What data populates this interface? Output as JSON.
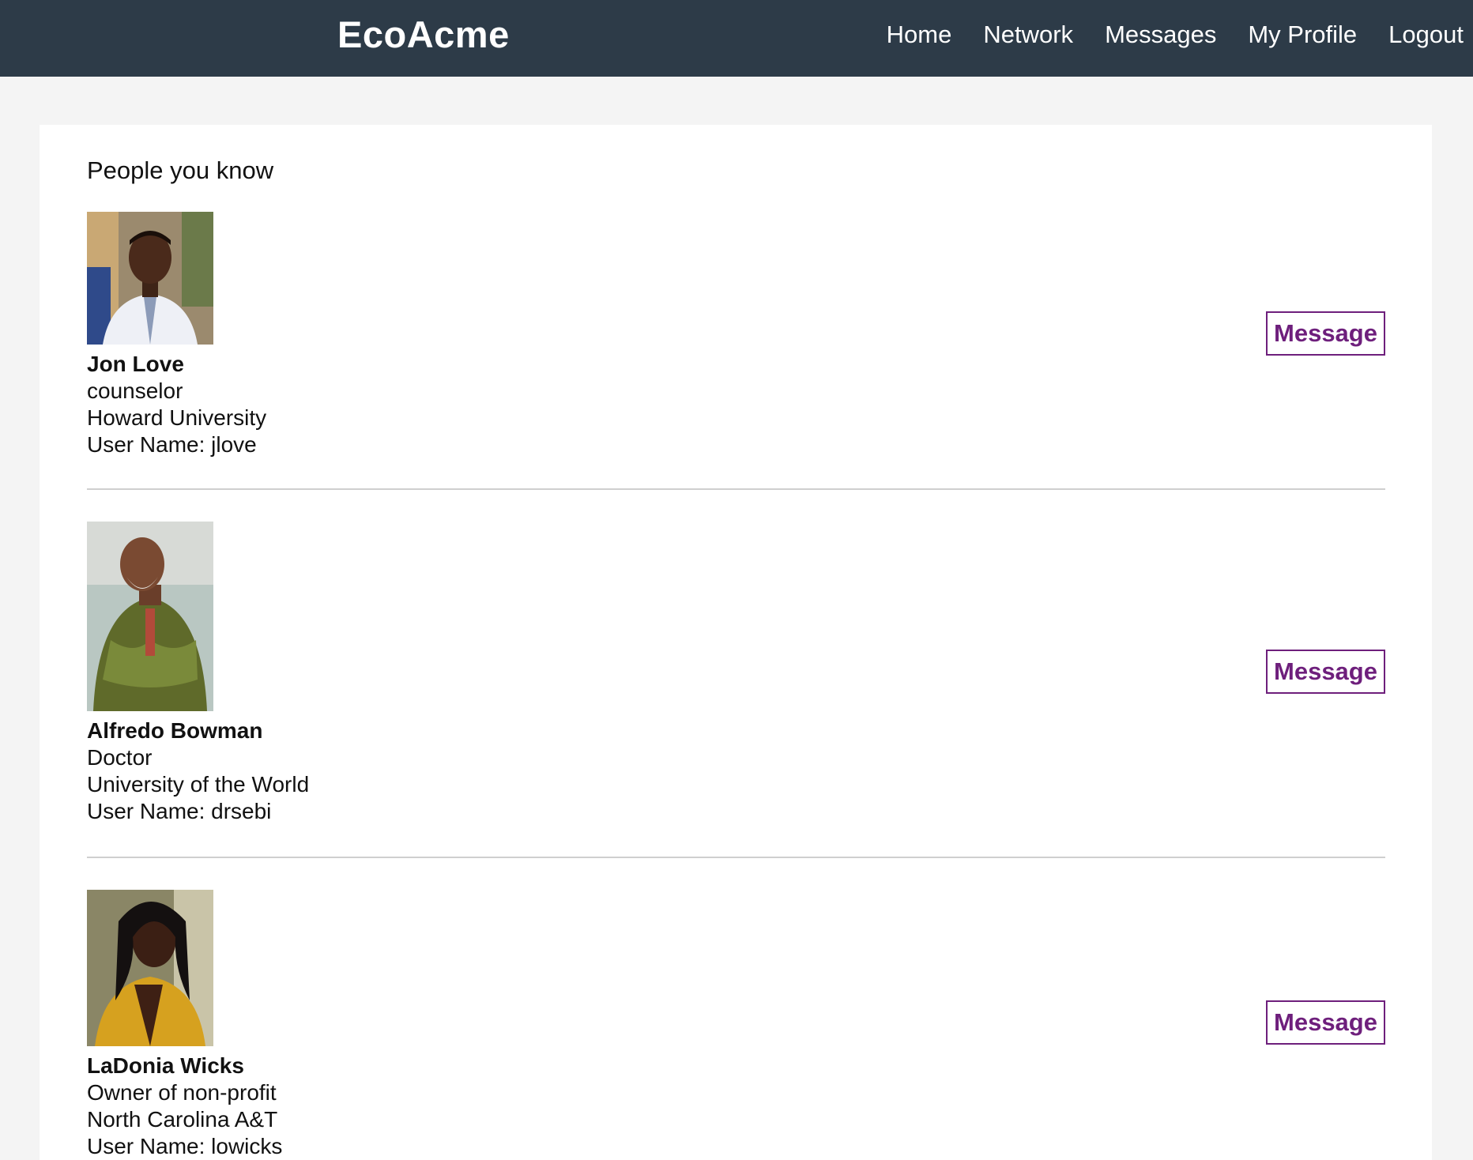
{
  "app": {
    "brand": "EcoAcme"
  },
  "nav": {
    "items": [
      {
        "label": "Home"
      },
      {
        "label": "Network"
      },
      {
        "label": "Messages"
      },
      {
        "label": "My Profile"
      },
      {
        "label": "Logout"
      }
    ]
  },
  "main": {
    "section_title": "People you know",
    "people": [
      {
        "name": "Jon Love",
        "title": "counselor",
        "school": "Howard University",
        "username": "User Name: jlove",
        "button_label": "Message"
      },
      {
        "name": "Alfredo Bowman",
        "title": "Doctor",
        "school": "University of the World",
        "username": "User Name: drsebi",
        "button_label": "Message"
      },
      {
        "name": "LaDonia Wicks",
        "title": "Owner of non-profit",
        "school": "North Carolina A&T",
        "username": "User Name: lowicks",
        "button_label": "Message"
      }
    ]
  },
  "colors": {
    "topbar": "#2d3b48",
    "accent": "#6e1f7c",
    "page_bg": "#f4f4f4"
  }
}
